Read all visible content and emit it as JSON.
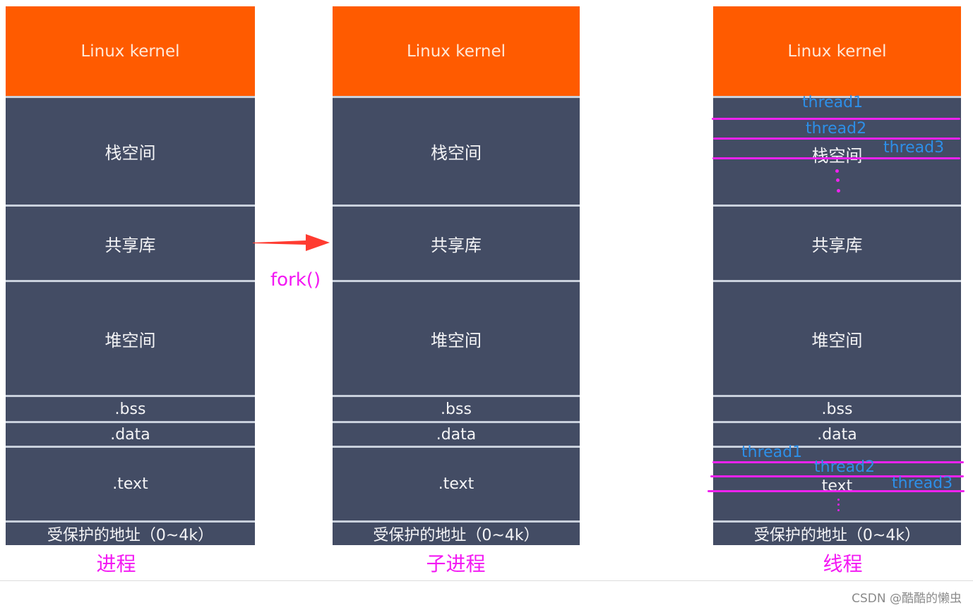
{
  "columns": [
    {
      "id": "process",
      "caption": "进程",
      "segments": {
        "kernel": "Linux kernel",
        "stack": "栈空间",
        "shared_lib": "共享库",
        "heap": "堆空间",
        "bss": ".bss",
        "data": ".data",
        "text": ".text",
        "protected": "受保护的地址（0~4k）"
      }
    },
    {
      "id": "child-process",
      "caption": "子进程",
      "segments": {
        "kernel": "Linux kernel",
        "stack": "栈空间",
        "shared_lib": "共享库",
        "heap": "堆空间",
        "bss": ".bss",
        "data": ".data",
        "text": ".text",
        "protected": "受保护的地址（0~4k）"
      }
    },
    {
      "id": "thread",
      "caption": "线程",
      "segments": {
        "kernel": "Linux kernel",
        "stack": "栈空间",
        "shared_lib": "共享库",
        "heap": "堆空间",
        "bss": ".bss",
        "data": ".data",
        "text": "text",
        "protected": "受保护的地址（0~4k）"
      },
      "stack_threads": [
        "thread1",
        "thread2",
        "thread3"
      ],
      "text_threads": [
        "thread1",
        "thread2",
        "thread3"
      ]
    }
  ],
  "arrow": {
    "label": "fork()",
    "color": "#ff3b30"
  },
  "colors": {
    "kernel": "#ff5b00",
    "segment": "#434c64",
    "annotation": "#f318f3",
    "thread_label": "#2d8fe8"
  },
  "watermark": "CSDN @酷酷的懒虫"
}
